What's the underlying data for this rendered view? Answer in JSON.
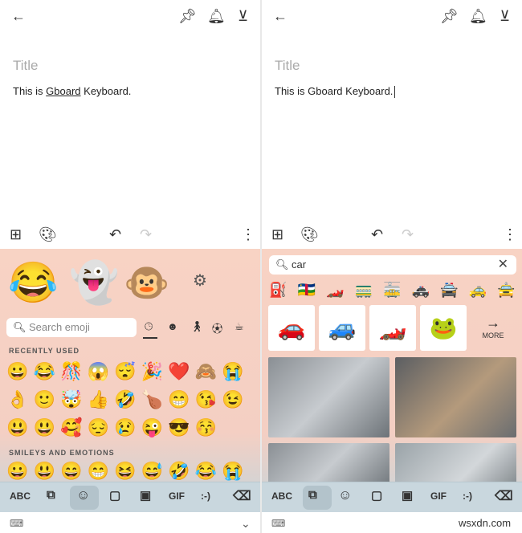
{
  "left": {
    "title_placeholder": "Title",
    "body_before": "This is ",
    "body_word": "Gboard",
    "body_after": " Keyboard.",
    "featured_emojis": [
      "😂",
      "👻",
      "🐵"
    ],
    "search_placeholder": "Search emoji",
    "recently_used_label": "RECENTLY USED",
    "recent_emojis": [
      "😀",
      "😂",
      "🎊",
      "😱",
      "😴",
      "🎉",
      "❤️",
      "🙈",
      "😭",
      "👌",
      "🙂",
      "🤯",
      "👍",
      "🤣",
      "🍗",
      "😁",
      "😘",
      "😉",
      "😃",
      "😃",
      "🥰",
      "😔",
      "😢",
      "😜",
      "😎",
      "😚"
    ],
    "smileys_label": "SMILEYS AND EMOTIONS",
    "smiley_emojis": [
      "😀",
      "😃",
      "😄",
      "😁",
      "😆",
      "😅",
      "🤣",
      "😂",
      "😭"
    ],
    "categories": [
      "recent-clock-icon",
      "smiley-icon",
      "person-icon",
      "activity-icon",
      "food-icon"
    ]
  },
  "right": {
    "title_placeholder": "Title",
    "body": "This is Gboard Keyboard.",
    "search_value": "car",
    "emoji_results": [
      "⛽",
      "🇨🇫",
      "🏎️",
      "🚃",
      "🚋",
      "🚓",
      "🚔",
      "🚕",
      "🚖"
    ],
    "stickers": [
      "🚗",
      "🚙",
      "🏎️",
      "🐸"
    ],
    "more_label": "MORE"
  },
  "keyboard_bar": {
    "abc": "ABC",
    "gif": "GIF",
    "emoticon": ":-)"
  },
  "watermark": "wsxdn.com"
}
